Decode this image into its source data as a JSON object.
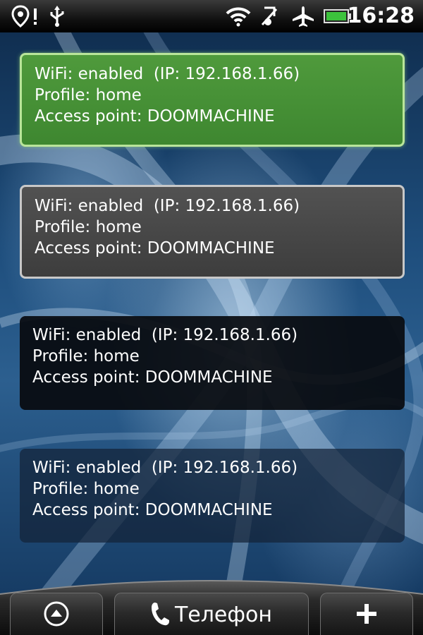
{
  "status_bar": {
    "time": "16:28",
    "icons": [
      "location-pin-icon",
      "alert-icon",
      "usb-icon",
      "wifi-icon",
      "vibrate-off-icon",
      "airplane-icon",
      "battery-icon"
    ]
  },
  "widgets": [
    {
      "style": "green",
      "wifi_line": "WiFi: enabled  (IP: 192.168.1.66)",
      "profile_line": "Profile: home",
      "access_point_line": "Access point: DOOMMACHINE"
    },
    {
      "style": "gray",
      "wifi_line": "WiFi: enabled  (IP: 192.168.1.66)",
      "profile_line": "Profile: home",
      "access_point_line": "Access point: DOOMMACHINE"
    },
    {
      "style": "black",
      "wifi_line": "WiFi: enabled  (IP: 192.168.1.66)",
      "profile_line": "Profile: home",
      "access_point_line": "Access point: DOOMMACHINE"
    },
    {
      "style": "transparent",
      "wifi_line": "WiFi: enabled  (IP: 192.168.1.66)",
      "profile_line": "Profile: home",
      "access_point_line": "Access point: DOOMMACHINE"
    }
  ],
  "dock": {
    "phone_label": "Телефон",
    "left_icon": "chevron-up-circle-icon",
    "right_icon": "plus-icon"
  },
  "colors": {
    "green_widget": "#4a9438",
    "gray_widget": "#474747",
    "status_bar": "#000000",
    "battery_fill": "#3cc23c"
  }
}
